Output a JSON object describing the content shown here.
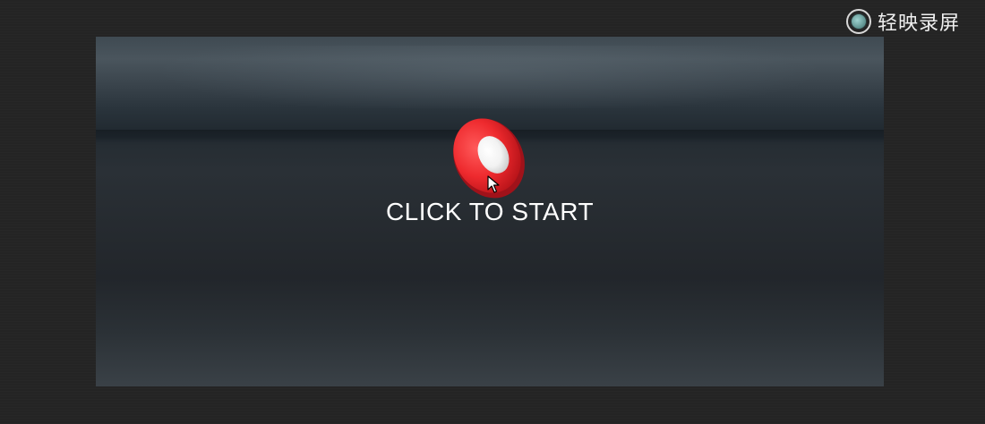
{
  "watermark": {
    "label": "轻映录屏",
    "icon": "record-icon"
  },
  "game": {
    "start_label": "CLICK TO START",
    "start_icon": "red-orb-icon",
    "colors": {
      "orb_red": "#e8262b",
      "orb_highlight": "#ffffff",
      "text": "#ffffff"
    }
  }
}
